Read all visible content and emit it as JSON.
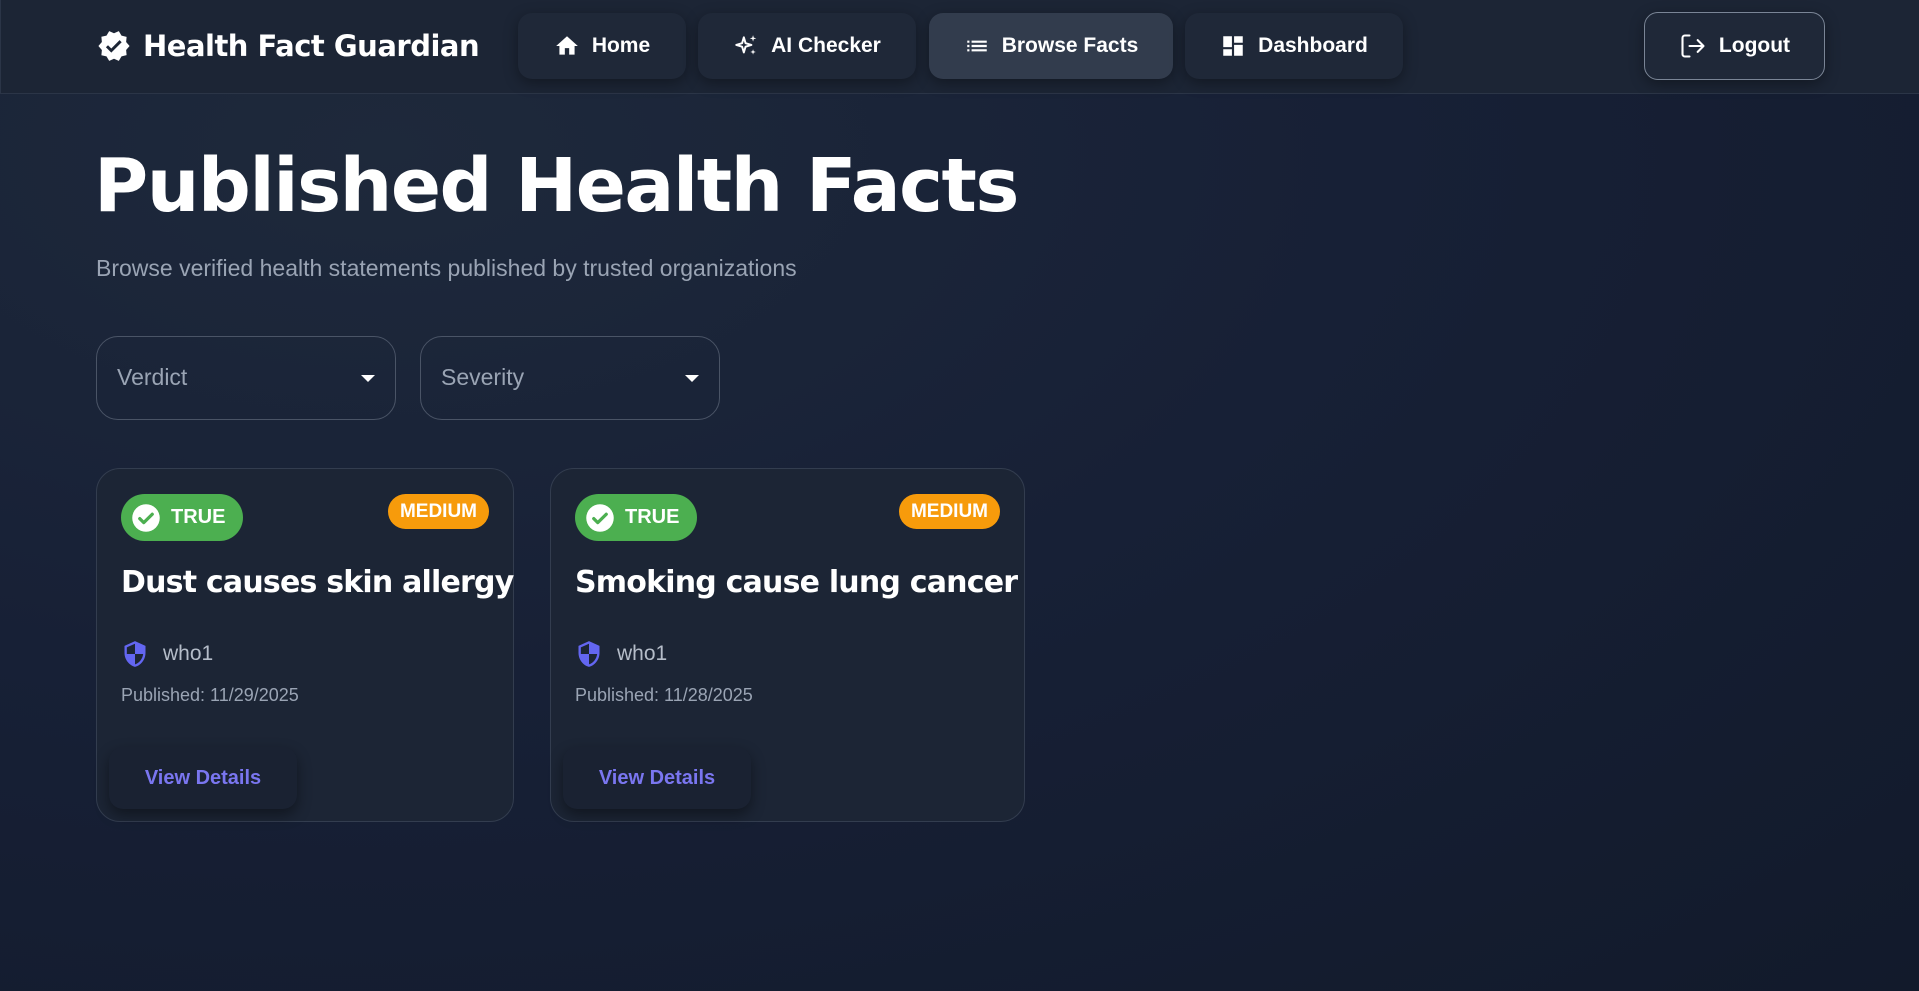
{
  "brand": {
    "title": "Health Fact Guardian",
    "icon": "verified-badge-icon"
  },
  "nav": [
    {
      "label": "Home",
      "icon": "home-icon",
      "active": false
    },
    {
      "label": "AI Checker",
      "icon": "sparkles-icon",
      "active": false
    },
    {
      "label": "Browse Facts",
      "icon": "list-icon",
      "active": true
    },
    {
      "label": "Dashboard",
      "icon": "dashboard-icon",
      "active": false
    }
  ],
  "logout": {
    "label": "Logout",
    "icon": "logout-icon"
  },
  "page": {
    "title": "Published Health Facts",
    "subtitle": "Browse verified health statements published by trusted organizations"
  },
  "filters": {
    "verdict": {
      "label": "Verdict",
      "icon": "caret-down-icon"
    },
    "severity": {
      "label": "Severity",
      "icon": "caret-down-icon"
    }
  },
  "facts": [
    {
      "verdict": "TRUE",
      "severity": "MEDIUM",
      "title": "Dust causes skin allergy",
      "publisher": "who1",
      "published": "Published: 11/29/2025",
      "action": "View Details"
    },
    {
      "verdict": "TRUE",
      "severity": "MEDIUM",
      "title": "Smoking cause lung cancer",
      "publisher": "who1",
      "published": "Published: 11/28/2025",
      "action": "View Details"
    }
  ],
  "colors": {
    "background": "#161f31",
    "topbar": "#1c2535",
    "active_nav": "#323c4d",
    "verdict_true": "#4caf50",
    "severity_medium": "#f79b0b",
    "accent": "#7a76f0",
    "publisher_icon": "#6366f1"
  }
}
